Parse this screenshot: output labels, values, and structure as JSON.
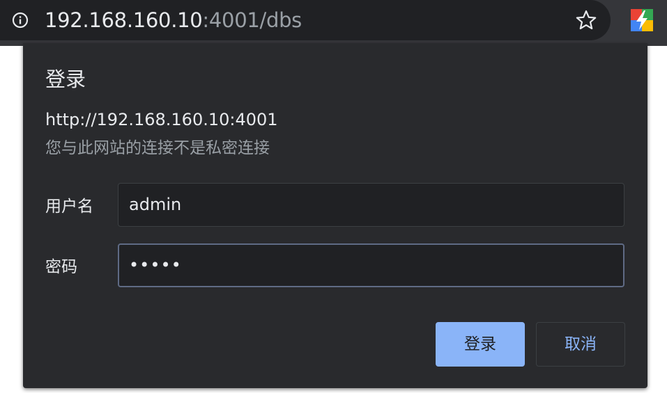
{
  "browser": {
    "url_host": "192.168.160.10",
    "url_rest": ":4001/dbs",
    "info_icon": "info-icon",
    "bookmark_icon": "star-icon",
    "extension_icon": "lightning-extension-icon"
  },
  "auth_dialog": {
    "title": "登录",
    "origin": "http://192.168.160.10:4001",
    "warning": "您与此网站的连接不是私密连接",
    "username_label": "用户名",
    "username_value": "admin",
    "password_label": "密码",
    "password_mask": "•••••",
    "login_button": "登录",
    "cancel_button": "取消"
  },
  "colors": {
    "accent": "#8ab4f8",
    "dialog_bg": "#292a2d",
    "field_bg": "#202124"
  }
}
